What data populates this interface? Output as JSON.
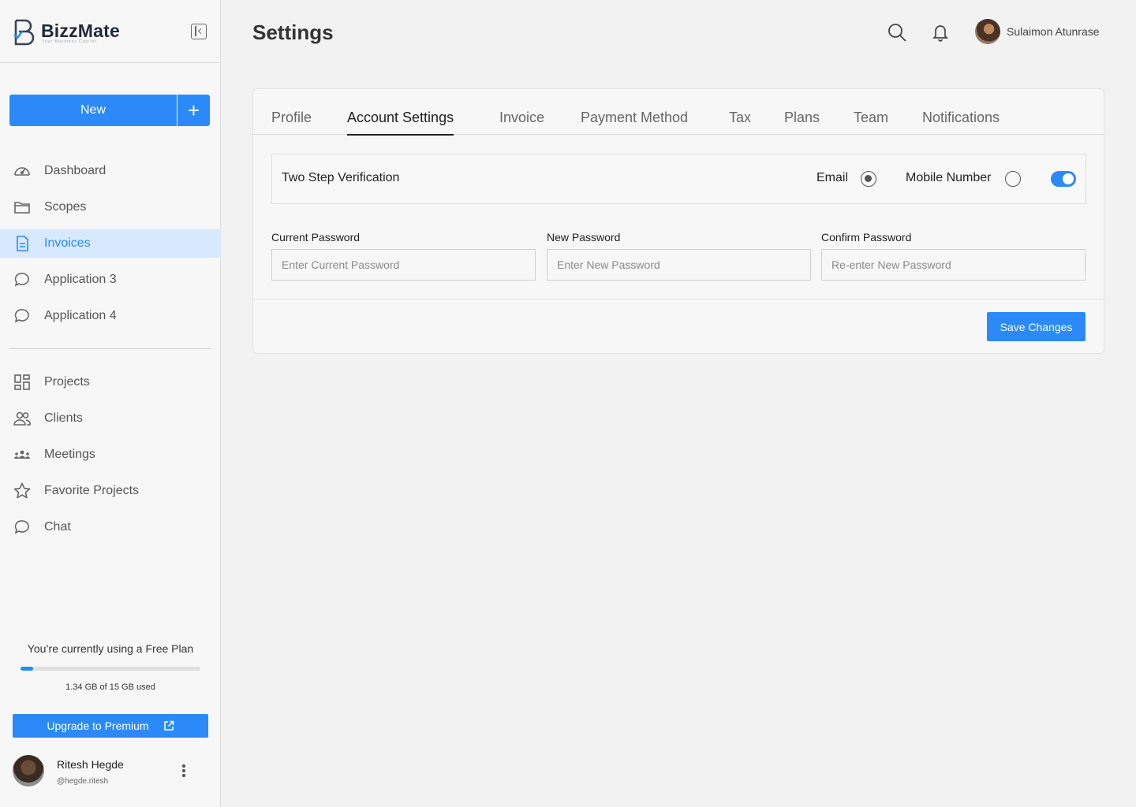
{
  "brand": {
    "name": "BizzMate",
    "tagline": "Your Business Copilot",
    "accent": "#2b8af7"
  },
  "sidebar": {
    "new_label": "New",
    "new_plus_label": "+",
    "nav_primary": [
      {
        "label": "Dashboard",
        "icon": "dashboard-gauge-icon"
      },
      {
        "label": "Scopes",
        "icon": "folder-icon"
      },
      {
        "label": "Invoices",
        "icon": "document-icon",
        "active": true
      },
      {
        "label": "Application 3",
        "icon": "chat-bubble-icon"
      },
      {
        "label": "Application 4",
        "icon": "chat-bubble-icon"
      }
    ],
    "nav_secondary": [
      {
        "label": "Projects",
        "icon": "grid-icon"
      },
      {
        "label": "Clients",
        "icon": "users-icon"
      },
      {
        "label": "Meetings",
        "icon": "group-icon"
      },
      {
        "label": "Favorite Projects",
        "icon": "star-icon"
      },
      {
        "label": "Chat",
        "icon": "chat-bubble-icon"
      }
    ],
    "plan_text": "You’re currently using a Free Plan",
    "storage_used_fraction": 0.07,
    "storage_text": "1.34 GB of 15 GB used",
    "upgrade_label": "Upgrade to Premium",
    "user": {
      "name": "Ritesh Hegde",
      "handle": "@hegde.ritesh"
    }
  },
  "header": {
    "title": "Settings",
    "user_name": "Sulaimon Atunrase"
  },
  "tabs": [
    {
      "label": "Profile"
    },
    {
      "label": "Account Settings",
      "active": true
    },
    {
      "label": "Invoice"
    },
    {
      "label": "Payment Method"
    },
    {
      "label": "Tax"
    },
    {
      "label": "Plans"
    },
    {
      "label": "Team"
    },
    {
      "label": "Notifications"
    }
  ],
  "two_step": {
    "label": "Two Step Verification",
    "email_label": "Email",
    "email_selected": true,
    "mobile_label": "Mobile Number",
    "mobile_selected": false,
    "enabled": true
  },
  "password_fields": [
    {
      "label": "Current Password",
      "placeholder": "Enter Current Password"
    },
    {
      "label": "New Password",
      "placeholder": "Enter New Password"
    },
    {
      "label": "Confirm Password",
      "placeholder": "Re-enter New Password"
    }
  ],
  "save_label": "Save Changes"
}
